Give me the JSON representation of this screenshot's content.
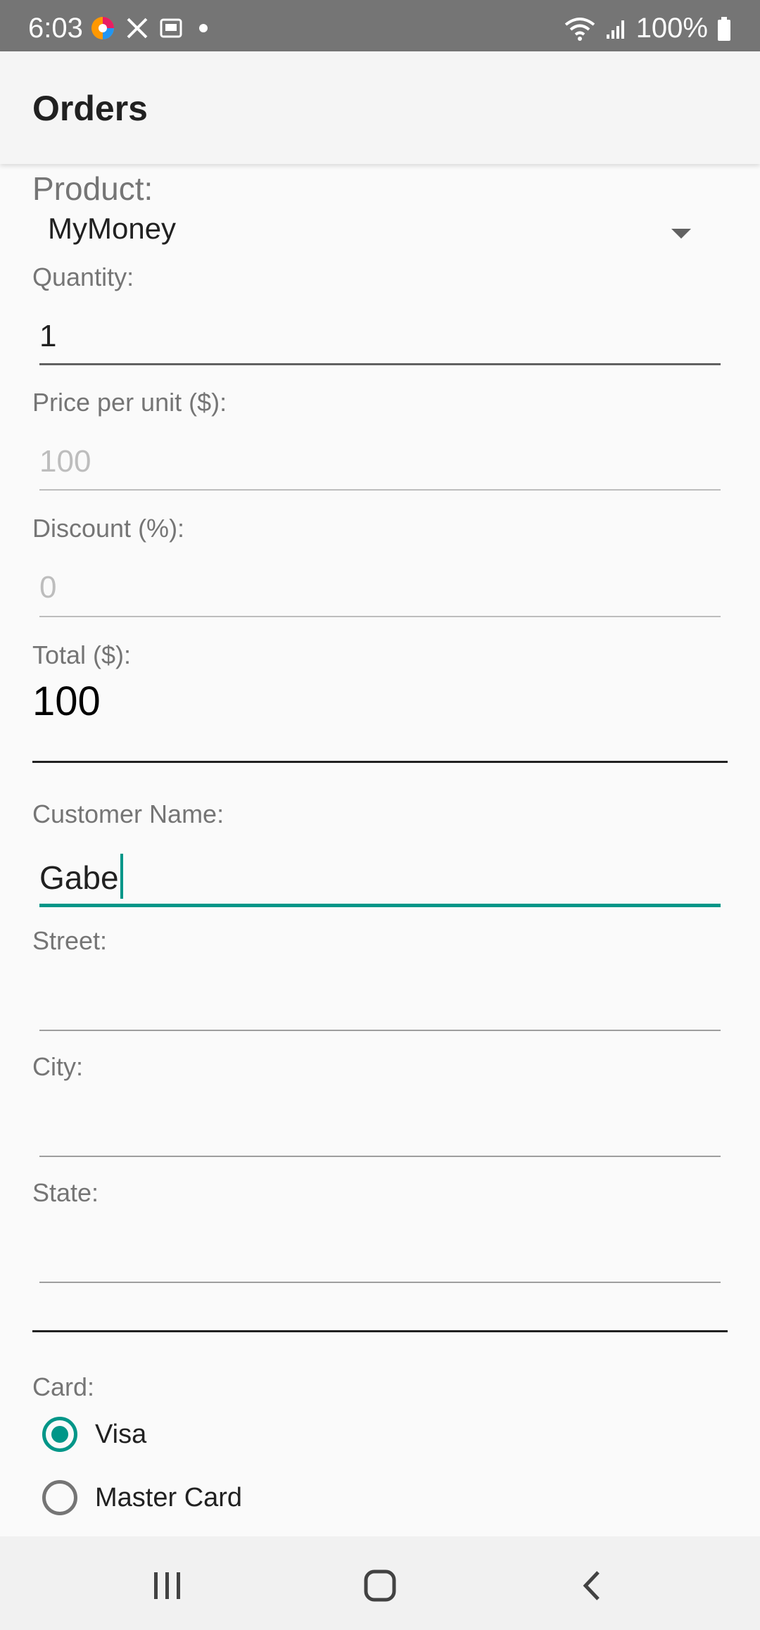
{
  "status_bar": {
    "time": "6:03",
    "battery": "100%",
    "icons_left": [
      "browser-icon",
      "tools-icon",
      "screen-icon",
      "dot-icon"
    ],
    "icons_right": [
      "wifi-icon",
      "signal-icon",
      "battery-icon"
    ]
  },
  "app_bar": {
    "title": "Orders"
  },
  "form": {
    "product": {
      "label": "Product:",
      "value": "MyMoney"
    },
    "quantity": {
      "label": "Quantity:",
      "value": "1"
    },
    "price": {
      "label": "Price per unit ($):",
      "value": "100"
    },
    "discount": {
      "label": "Discount (%):",
      "value": "0"
    },
    "total": {
      "label": "Total ($):",
      "value": "100"
    },
    "customer_name": {
      "label": "Customer Name:",
      "value": "Gabe"
    },
    "street": {
      "label": "Street:",
      "value": ""
    },
    "city": {
      "label": "City:",
      "value": ""
    },
    "state": {
      "label": "State:",
      "value": ""
    },
    "card": {
      "label": "Card:",
      "options": [
        {
          "label": "Visa",
          "checked": true
        },
        {
          "label": "Master Card",
          "checked": false
        }
      ]
    }
  },
  "colors": {
    "accent": "#009688",
    "status_bar": "#757575",
    "app_bar": "#f5f5f5"
  },
  "nav_bar": {
    "buttons": [
      "recent-apps-icon",
      "home-icon",
      "back-icon"
    ]
  }
}
